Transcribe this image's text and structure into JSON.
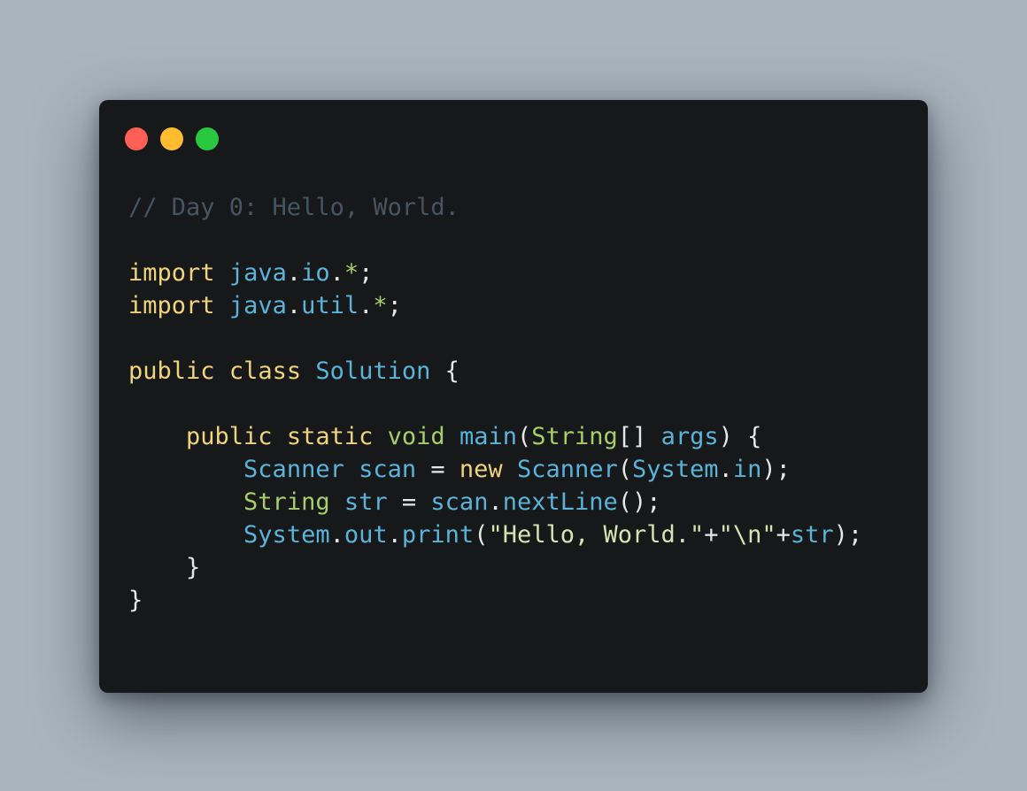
{
  "window": {
    "buttons": [
      {
        "name": "close",
        "color": "#fe5f57"
      },
      {
        "name": "minimize",
        "color": "#febc2e"
      },
      {
        "name": "maximize",
        "color": "#28c840"
      }
    ]
  },
  "colors": {
    "background": "#a9b4bf",
    "window": "#17181a",
    "comment": "#475563",
    "keyword": "#f0d47c",
    "type": "#5ab4d9",
    "builtin": "#a6cf6a",
    "text": "#e6e6e6",
    "string": "#d7e4b2"
  },
  "code": {
    "lines": [
      [
        {
          "t": "// Day 0: Hello, World.",
          "c": "comment"
        }
      ],
      [],
      [
        {
          "t": "import",
          "c": "keyword"
        },
        {
          "t": " ",
          "c": "text"
        },
        {
          "t": "java",
          "c": "type"
        },
        {
          "t": ".",
          "c": "text"
        },
        {
          "t": "io",
          "c": "type"
        },
        {
          "t": ".",
          "c": "text"
        },
        {
          "t": "*",
          "c": "builtin"
        },
        {
          "t": ";",
          "c": "text"
        }
      ],
      [
        {
          "t": "import",
          "c": "keyword"
        },
        {
          "t": " ",
          "c": "text"
        },
        {
          "t": "java",
          "c": "type"
        },
        {
          "t": ".",
          "c": "text"
        },
        {
          "t": "util",
          "c": "type"
        },
        {
          "t": ".",
          "c": "text"
        },
        {
          "t": "*",
          "c": "builtin"
        },
        {
          "t": ";",
          "c": "text"
        }
      ],
      [],
      [
        {
          "t": "public",
          "c": "keyword"
        },
        {
          "t": " ",
          "c": "text"
        },
        {
          "t": "class",
          "c": "keyword"
        },
        {
          "t": " ",
          "c": "text"
        },
        {
          "t": "Solution",
          "c": "type"
        },
        {
          "t": " {",
          "c": "text"
        }
      ],
      [],
      [
        {
          "t": "    ",
          "c": "text"
        },
        {
          "t": "public",
          "c": "keyword"
        },
        {
          "t": " ",
          "c": "text"
        },
        {
          "t": "static",
          "c": "keyword"
        },
        {
          "t": " ",
          "c": "text"
        },
        {
          "t": "void",
          "c": "builtin"
        },
        {
          "t": " ",
          "c": "text"
        },
        {
          "t": "main",
          "c": "type"
        },
        {
          "t": "(",
          "c": "text"
        },
        {
          "t": "String",
          "c": "builtin"
        },
        {
          "t": "[] ",
          "c": "text"
        },
        {
          "t": "args",
          "c": "type"
        },
        {
          "t": ") {",
          "c": "text"
        }
      ],
      [
        {
          "t": "        ",
          "c": "text"
        },
        {
          "t": "Scanner",
          "c": "type"
        },
        {
          "t": " ",
          "c": "text"
        },
        {
          "t": "scan",
          "c": "type"
        },
        {
          "t": " = ",
          "c": "text"
        },
        {
          "t": "new",
          "c": "keyword"
        },
        {
          "t": " ",
          "c": "text"
        },
        {
          "t": "Scanner",
          "c": "type"
        },
        {
          "t": "(",
          "c": "text"
        },
        {
          "t": "System",
          "c": "type"
        },
        {
          "t": ".",
          "c": "text"
        },
        {
          "t": "in",
          "c": "type"
        },
        {
          "t": ");",
          "c": "text"
        }
      ],
      [
        {
          "t": "        ",
          "c": "text"
        },
        {
          "t": "String",
          "c": "builtin"
        },
        {
          "t": " ",
          "c": "text"
        },
        {
          "t": "str",
          "c": "type"
        },
        {
          "t": " = ",
          "c": "text"
        },
        {
          "t": "scan",
          "c": "type"
        },
        {
          "t": ".",
          "c": "text"
        },
        {
          "t": "nextLine",
          "c": "type"
        },
        {
          "t": "();",
          "c": "text"
        }
      ],
      [
        {
          "t": "        ",
          "c": "text"
        },
        {
          "t": "System",
          "c": "type"
        },
        {
          "t": ".",
          "c": "text"
        },
        {
          "t": "out",
          "c": "type"
        },
        {
          "t": ".",
          "c": "text"
        },
        {
          "t": "print",
          "c": "type"
        },
        {
          "t": "(",
          "c": "text"
        },
        {
          "t": "\"Hello, World.\"",
          "c": "string"
        },
        {
          "t": "+",
          "c": "text"
        },
        {
          "t": "\"\\n\"",
          "c": "string"
        },
        {
          "t": "+",
          "c": "text"
        },
        {
          "t": "str",
          "c": "type"
        },
        {
          "t": ");",
          "c": "text"
        }
      ],
      [
        {
          "t": "    }",
          "c": "text"
        }
      ],
      [
        {
          "t": "}",
          "c": "text"
        }
      ]
    ]
  }
}
